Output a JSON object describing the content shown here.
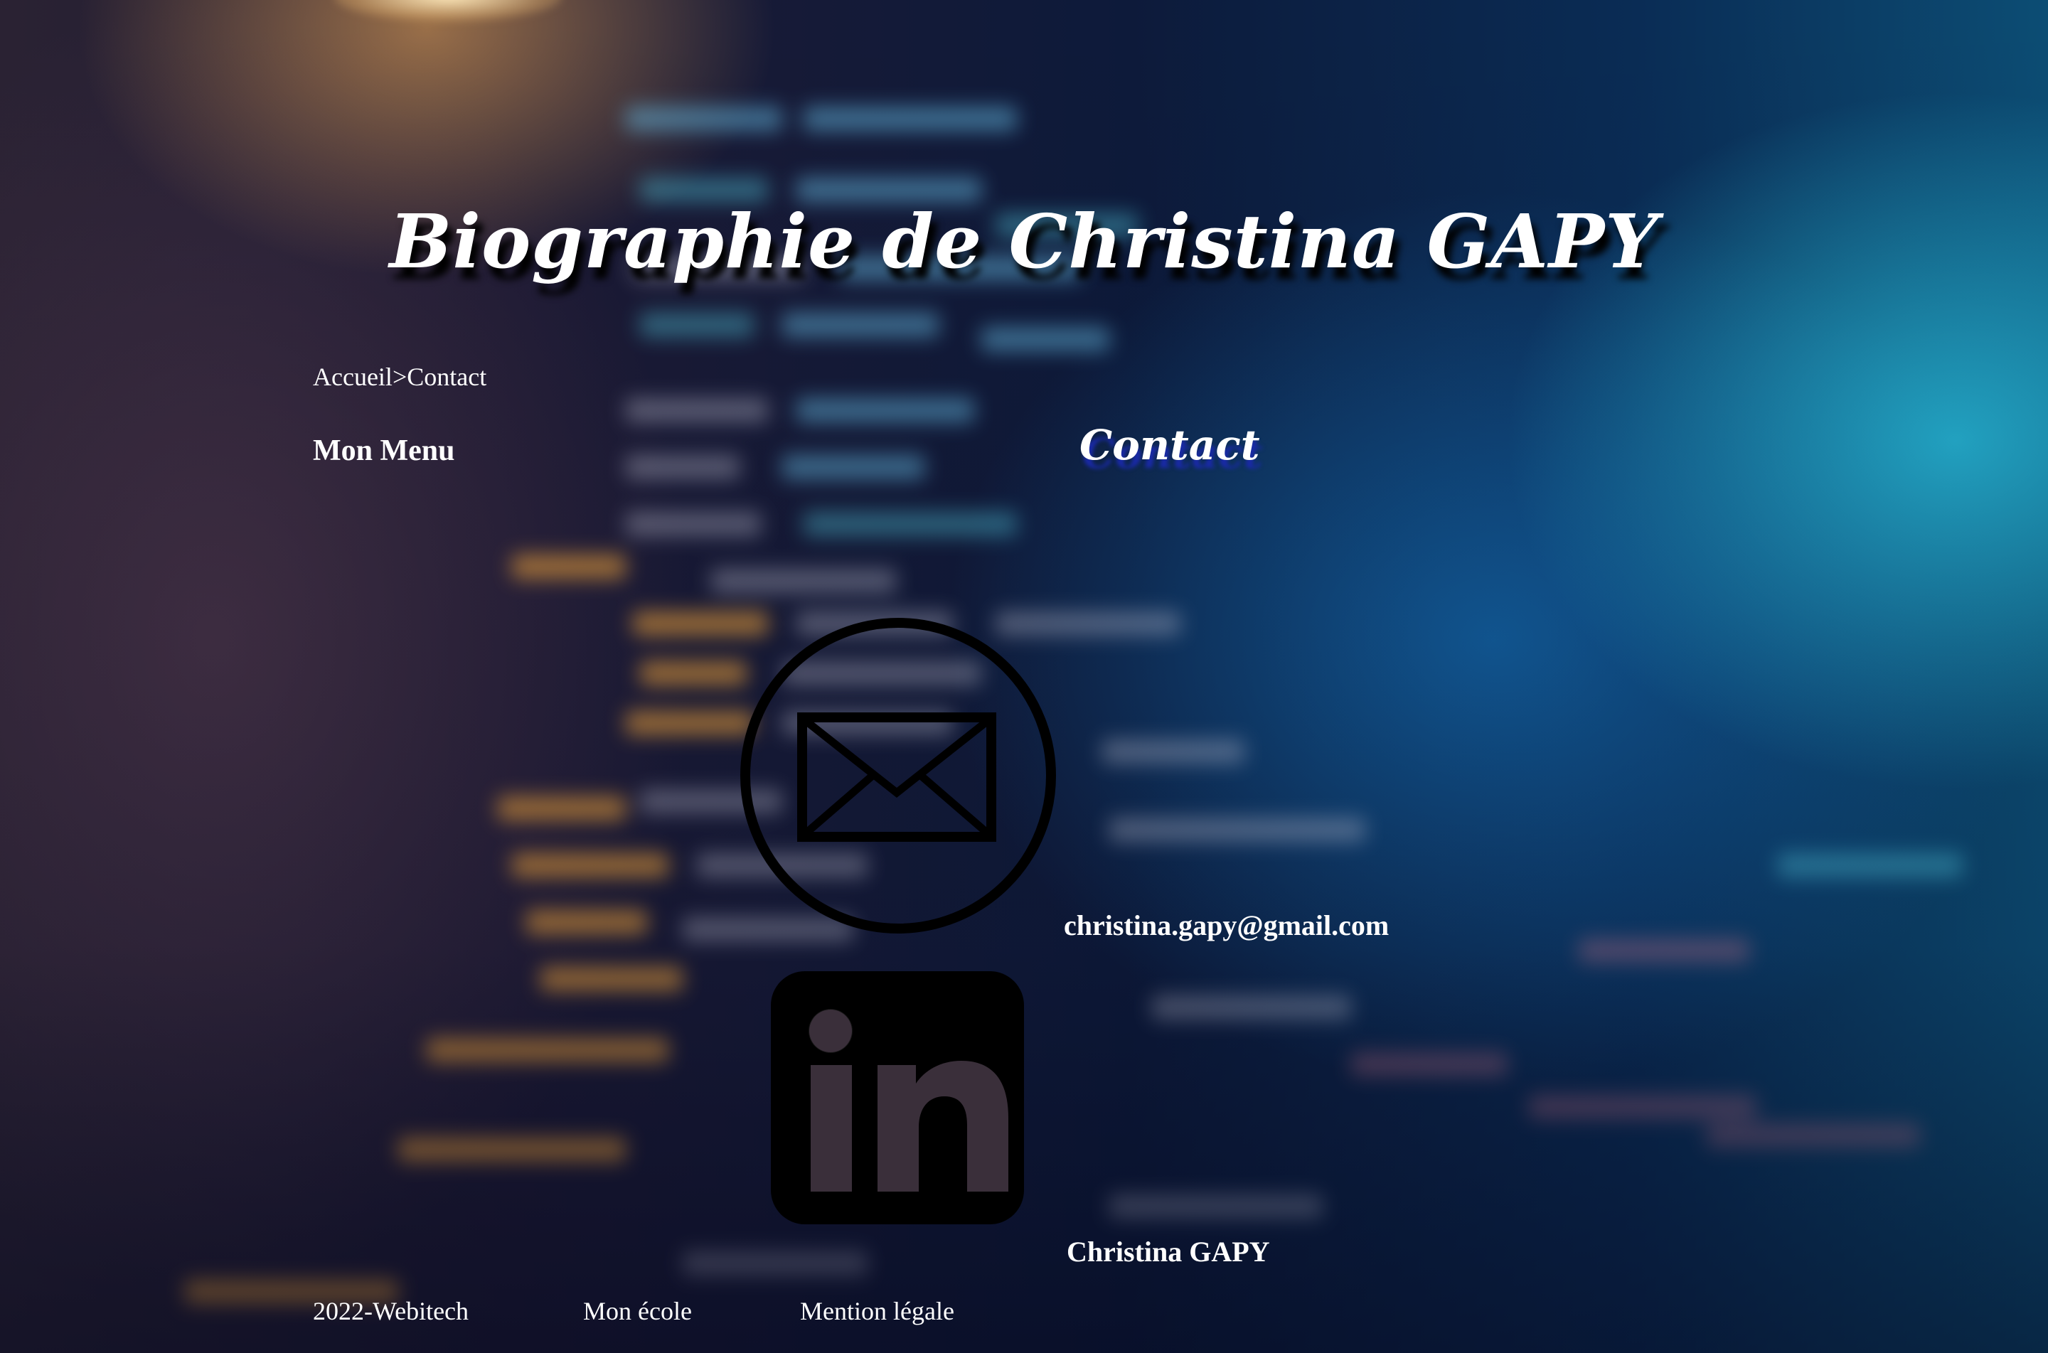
{
  "site": {
    "title": "Biographie de Christina GAPY"
  },
  "breadcrumb": {
    "home": "Accueil",
    "separator": ">",
    "current": "Contact"
  },
  "sidebar": {
    "menu_title": "Mon Menu"
  },
  "main": {
    "section_title": "Contact",
    "contacts": [
      {
        "icon": "mail-icon",
        "label": "christina.gapy@gmail.com"
      },
      {
        "icon": "linkedin-icon",
        "label": "Christina GAPY"
      }
    ]
  },
  "footer": {
    "items": [
      "2022-Webitech",
      "Mon école",
      "Mention légale"
    ]
  },
  "colors": {
    "text": "#ffffff",
    "title_shadow": "#000000",
    "section_shadow": "#1a2aa8",
    "icon": "#000000"
  }
}
